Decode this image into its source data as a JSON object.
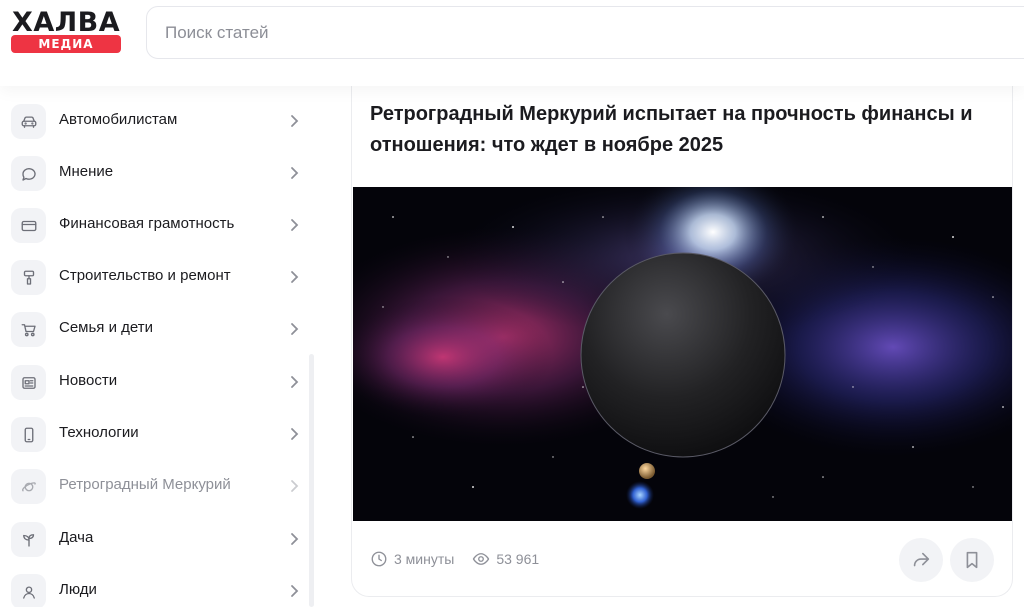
{
  "brand": {
    "name": "ХАЛВА",
    "sub": "МЕДИА",
    "accent_color": "#ee3443"
  },
  "search": {
    "placeholder": "Поиск статей"
  },
  "sidebar": {
    "items": [
      {
        "label": "Автомобилистам",
        "icon": "car-icon"
      },
      {
        "label": "Мнение",
        "icon": "chat-bubble-icon"
      },
      {
        "label": "Финансовая грамотность",
        "icon": "credit-card-icon"
      },
      {
        "label": "Строительство и ремонт",
        "icon": "paint-roller-icon"
      },
      {
        "label": "Семья и дети",
        "icon": "stroller-icon"
      },
      {
        "label": "Новости",
        "icon": "newspaper-icon"
      },
      {
        "label": "Технологии",
        "icon": "smartphone-icon"
      },
      {
        "label": "Ретроградный Меркурий",
        "icon": "planet-icon",
        "muted": true
      },
      {
        "label": "Дача",
        "icon": "sprout-icon"
      },
      {
        "label": "Люди",
        "icon": "person-icon"
      }
    ]
  },
  "article": {
    "title": "Ретроградный Меркурий испытает на прочность финансы и отношения: что ждет в ноябре 2025",
    "read_time": "3 минуты",
    "views": "53 961",
    "image_alt_icon": "planet-space-image"
  }
}
